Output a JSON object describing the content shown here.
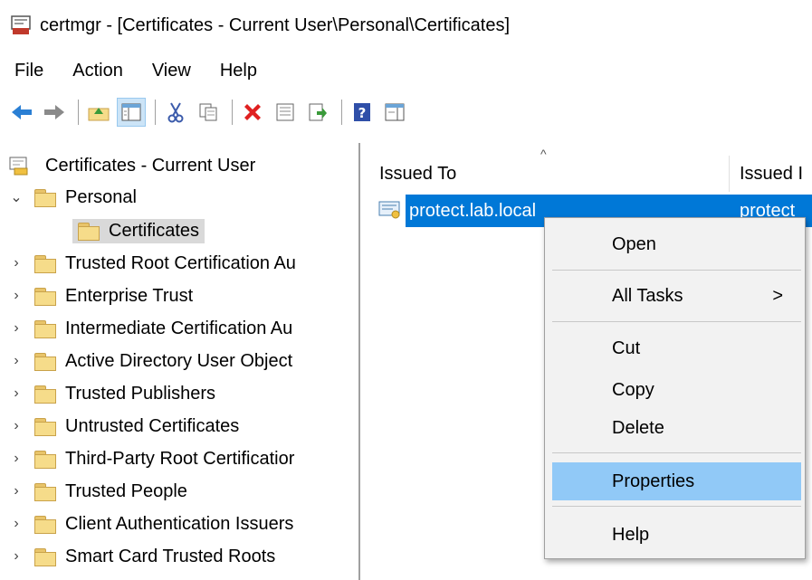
{
  "window": {
    "title": "certmgr - [Certificates - Current User\\Personal\\Certificates]"
  },
  "menu": [
    "File",
    "Action",
    "View",
    "Help"
  ],
  "toolbar": {
    "buttons": [
      "back-arrow-icon",
      "forward-arrow-icon",
      "up-folder-icon",
      "show-hide-tree-icon",
      "cut-icon",
      "copy-icon",
      "delete-icon",
      "properties-icon",
      "export-icon",
      "help-icon",
      "action-pane-icon"
    ]
  },
  "tree": {
    "root": "Certificates - Current User",
    "personal": "Personal",
    "certificates": "Certificates",
    "items": [
      "Trusted Root Certification Au",
      "Enterprise Trust",
      "Intermediate Certification Au",
      "Active Directory User Object",
      "Trusted Publishers",
      "Untrusted Certificates",
      "Third-Party Root Certificatior",
      "Trusted People",
      "Client Authentication Issuers",
      "Smart Card Trusted Roots"
    ]
  },
  "list": {
    "columns": [
      "Issued To",
      "Issued I"
    ],
    "rows": [
      {
        "issued_to": "protect.lab.local",
        "issued_by": "protect"
      }
    ]
  },
  "context_menu": {
    "open": "Open",
    "all_tasks": "All Tasks",
    "submenu_arrow": ">",
    "cut": "Cut",
    "copy": "Copy",
    "delete": "Delete",
    "properties": "Properties",
    "help": "Help"
  },
  "colors": {
    "selection": "#0078d7",
    "menu_highlight": "#91c9f7",
    "menu_bg": "#f2f2f2"
  }
}
